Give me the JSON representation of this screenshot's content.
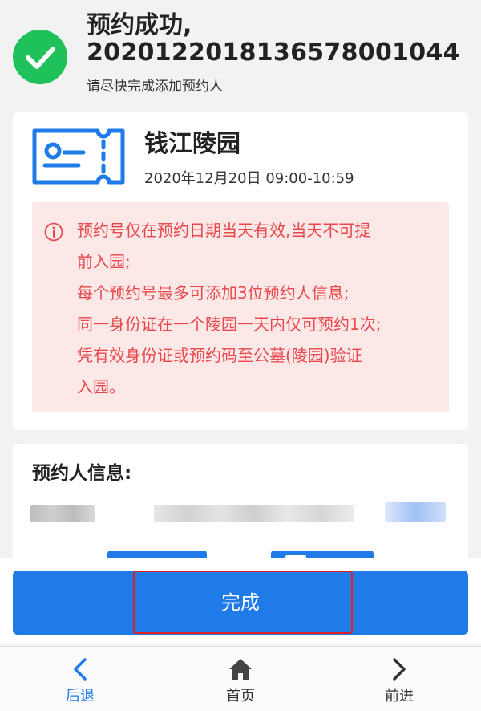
{
  "header": {
    "title_line1": "预约成功,",
    "title_line2": "2020122018136578001044",
    "subtitle": "请尽快完成添加预约人"
  },
  "venue": {
    "name": "钱江陵园",
    "datetime": "2020年12月20日 09:00-10:59"
  },
  "notice": {
    "lines": [
      "预约号仅在预约日期当天有效,当天不可提",
      "前入园;",
      "每个预约号最多可添加3位预约人信息;",
      "同一身份证在一个陵园一天内仅可预约1次;",
      "凭有效身份证或预约码至公墓(陵园)验证",
      "入园。"
    ]
  },
  "persons": {
    "title": "预约人信息:"
  },
  "actions": {
    "done_label": "完成"
  },
  "nav": {
    "back_label": "后退",
    "home_label": "首页",
    "forward_label": "前进"
  },
  "colors": {
    "accent": "#1e7be8",
    "success": "#1ec15a",
    "notice_text": "#e8474b",
    "notice_bg": "#fde8e8",
    "highlight": "#e02020"
  }
}
